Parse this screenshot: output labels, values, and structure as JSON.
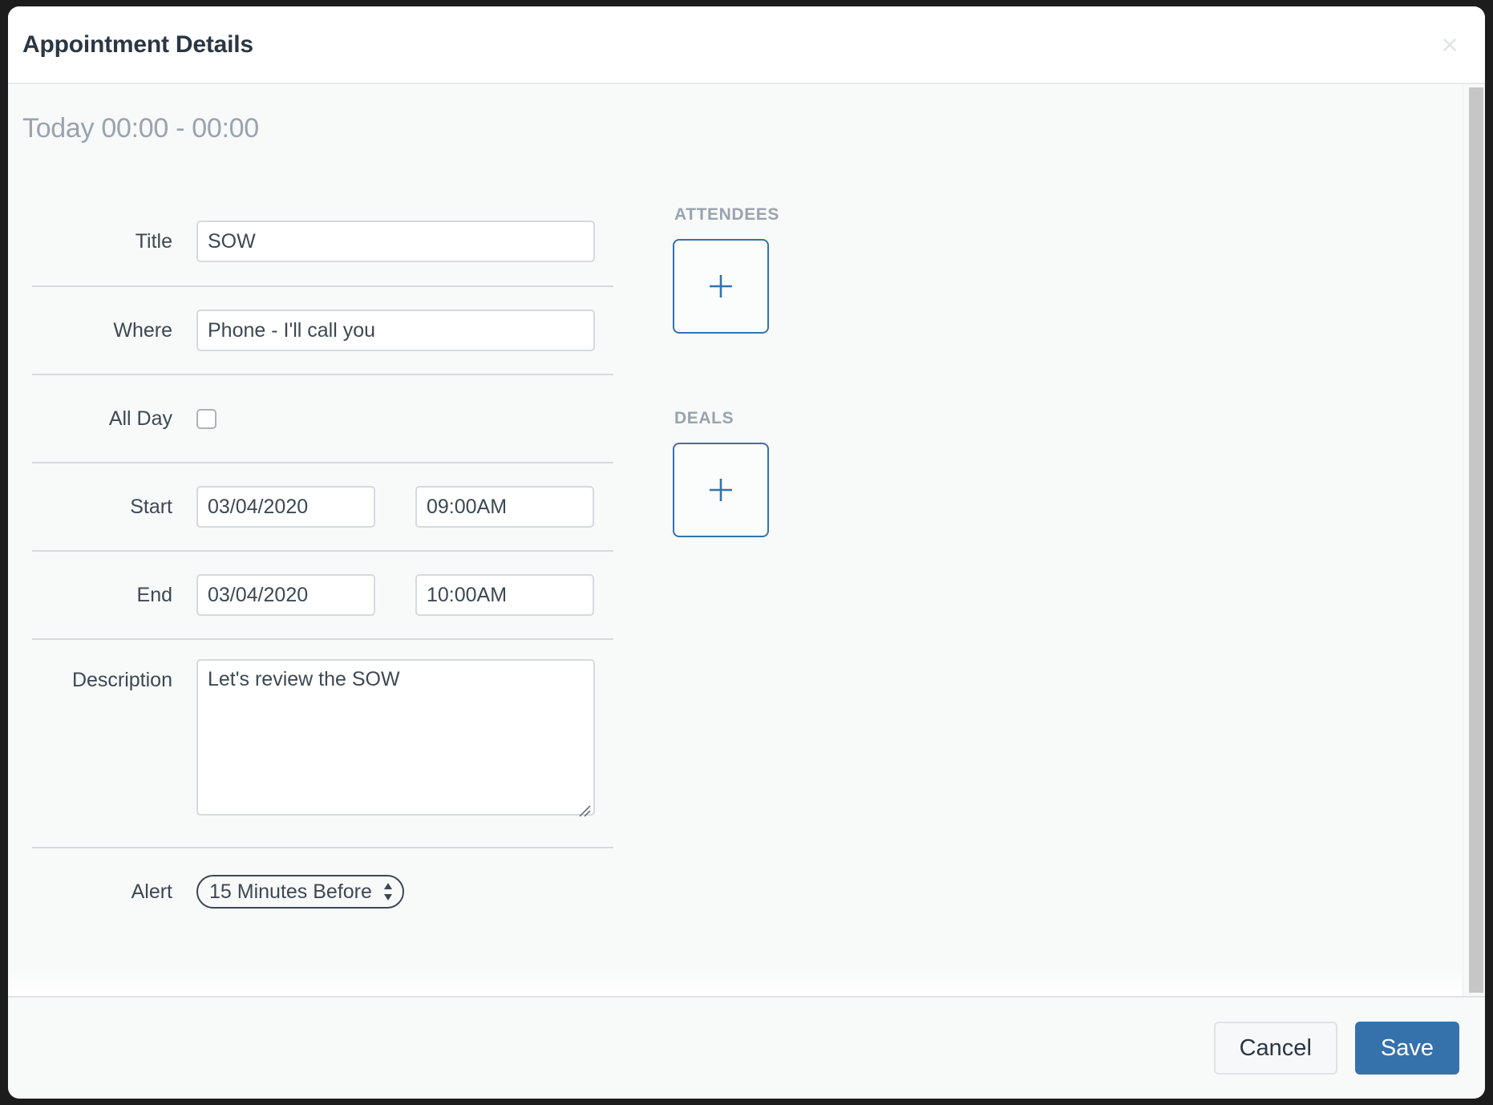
{
  "window": {
    "title": "Appointment Details",
    "close_label": "×",
    "close_icon": "close-icon"
  },
  "body": {
    "time_summary": "Today 00:00 - 00:00"
  },
  "form": {
    "rows": [
      {
        "label": "Title",
        "value": "SOW"
      },
      {
        "label": "Where",
        "value": "Phone - I'll call you"
      },
      {
        "label": "All Day",
        "checked": false
      },
      {
        "label": "Start",
        "date": "03/04/2020",
        "time": "09:00AM"
      },
      {
        "label": "End",
        "date": "03/04/2020",
        "time": "10:00AM"
      },
      {
        "label": "Description",
        "value": "Let's review the SOW"
      },
      {
        "label": "Alert",
        "value": "15 Minutes Before"
      }
    ],
    "title": {
      "label": "Title",
      "value": "SOW",
      "placeholder": ""
    },
    "where": {
      "label": "Where",
      "value": "Phone - I'll call you",
      "placeholder": ""
    },
    "all_day": {
      "label": "All Day",
      "checked": false
    },
    "start": {
      "label": "Start",
      "date": "03/04/2020",
      "time": "09:00AM"
    },
    "end": {
      "label": "End",
      "date": "03/04/2020",
      "time": "10:00AM"
    },
    "description": {
      "label": "Description",
      "value": "Let's review the SOW",
      "placeholder": ""
    },
    "alert": {
      "label": "Alert",
      "selected": "15 Minutes Before",
      "options": [
        "15 Minutes Before"
      ]
    }
  },
  "attendees": {
    "heading": "ATTENDEES",
    "add_icon": "plus-icon"
  },
  "deals": {
    "heading": "DEALS",
    "add_icon": "plus-icon"
  },
  "footer": {
    "cancel_label": "Cancel",
    "save_label": "Save"
  },
  "colors": {
    "accent": "#3572ac",
    "heading_text": "#9aa3ad",
    "body_text": "#3d4853",
    "title_text": "#2b3643",
    "field_border": "#d4dae0",
    "divider": "#d7dadd",
    "panel_bg": "#f8f9f9",
    "scrollbar_thumb": "#c6c6c6"
  }
}
